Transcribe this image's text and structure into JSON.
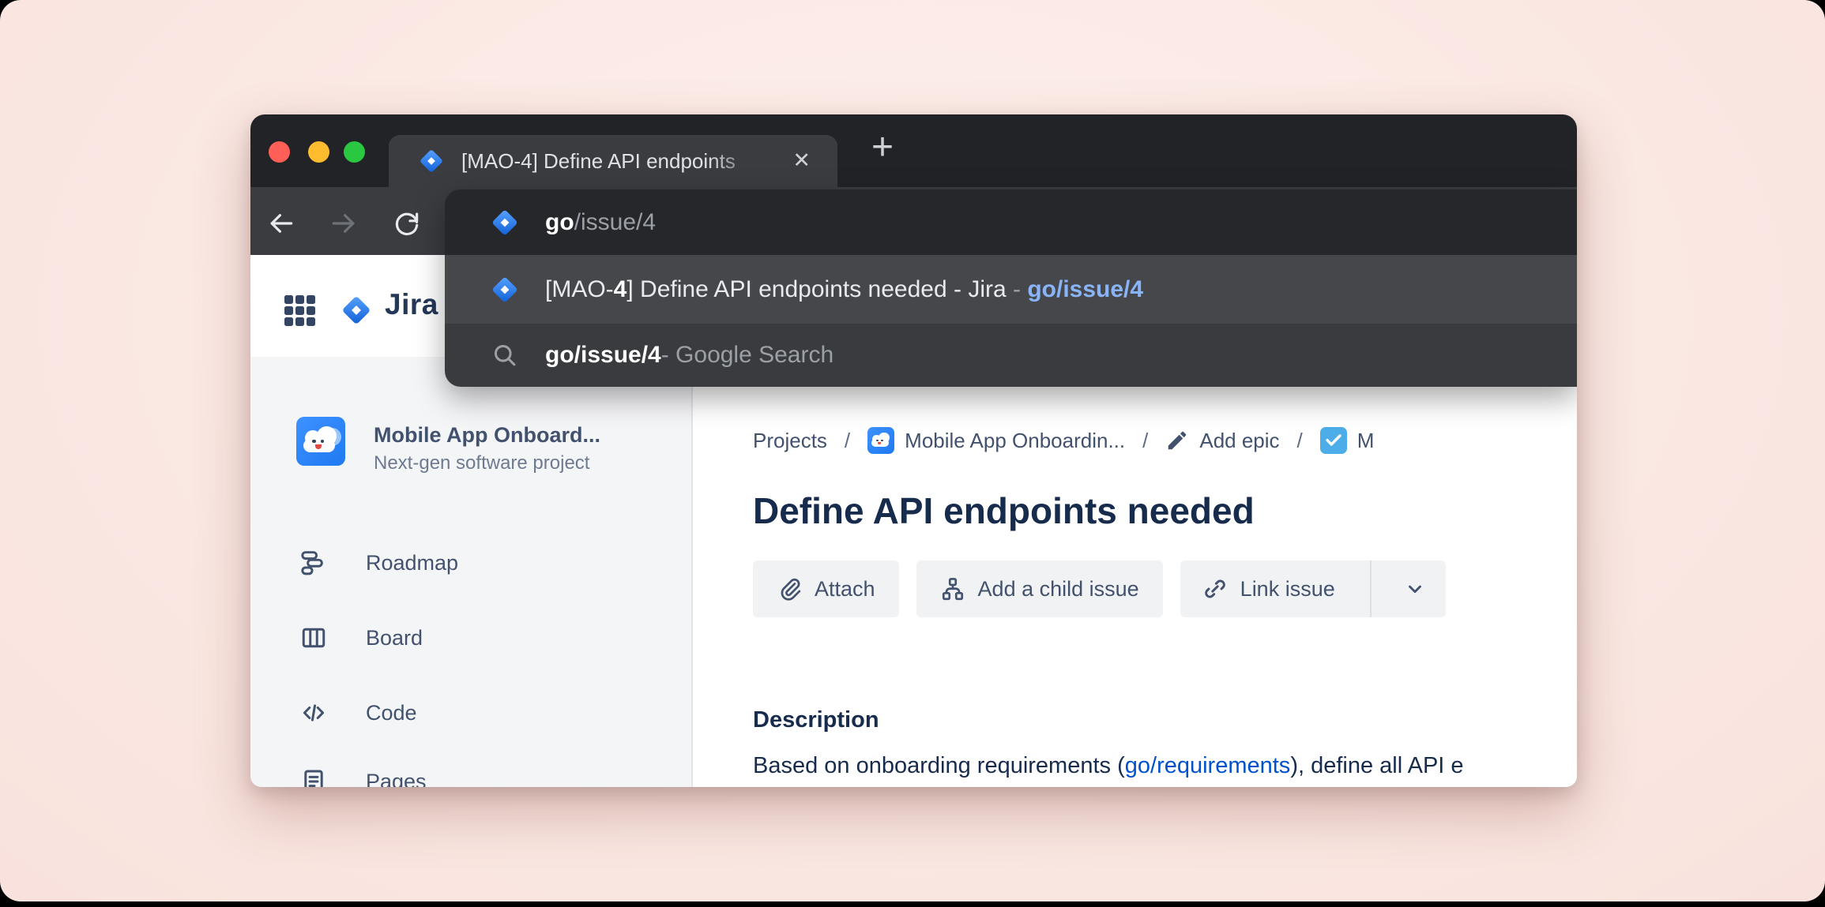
{
  "browser": {
    "tab": {
      "title": "[MAO-4] Define API endpoints",
      "close_glyph": "✕"
    },
    "new_tab_glyph": "+",
    "omnibox": {
      "query_bold": "go",
      "query_rest": "/issue/4"
    },
    "suggestions": {
      "jira": {
        "prefix": "[MAO-",
        "bold_match": "4",
        "middle": "] Define API endpoints needed - Jira",
        "dash": " - ",
        "url": "go/issue/4"
      },
      "search": {
        "query": "go/issue/4",
        "suffix": " - Google Search"
      }
    }
  },
  "jira": {
    "logo_text": "Jira",
    "project": {
      "name": "Mobile App Onboard...",
      "type": "Next-gen software project"
    },
    "nav": [
      {
        "label": "Roadmap"
      },
      {
        "label": "Board"
      },
      {
        "label": "Code"
      },
      {
        "label": "Pages"
      }
    ],
    "breadcrumb": {
      "projects": "Projects",
      "separator": "/",
      "project": "Mobile App Onboardin...",
      "add_epic": "Add epic",
      "more": "M"
    },
    "issue": {
      "title": "Define API endpoints needed",
      "actions": {
        "attach": "Attach",
        "add_child": "Add a child issue",
        "link_issue": "Link issue"
      },
      "description_heading": "Description",
      "description_pre": "Based on onboarding requirements (",
      "description_link": "go/requirements",
      "description_post": "), define all API e"
    }
  },
  "colors": {
    "backdrop_pink": "#fae6e1",
    "titlebar": "#222327",
    "tab_toolbar": "#3b3c40",
    "omnibox_bg": "#26272a",
    "suggestion_selected": "#46474b",
    "suggestion_default": "#3a3b3e",
    "suggestion_link_blue": "#8ab4f8",
    "jira_brand_blue": "#2684ff",
    "jira_navy": "#172b4d",
    "jira_ui_navy": "#42526e",
    "jira_link_blue": "#0052cc",
    "task_check_blue": "#4dade8",
    "sidebar_bg": "#f4f5f7",
    "traffic_red": "#ff5f57",
    "traffic_yellow": "#febc2e",
    "traffic_green": "#2ac840"
  }
}
